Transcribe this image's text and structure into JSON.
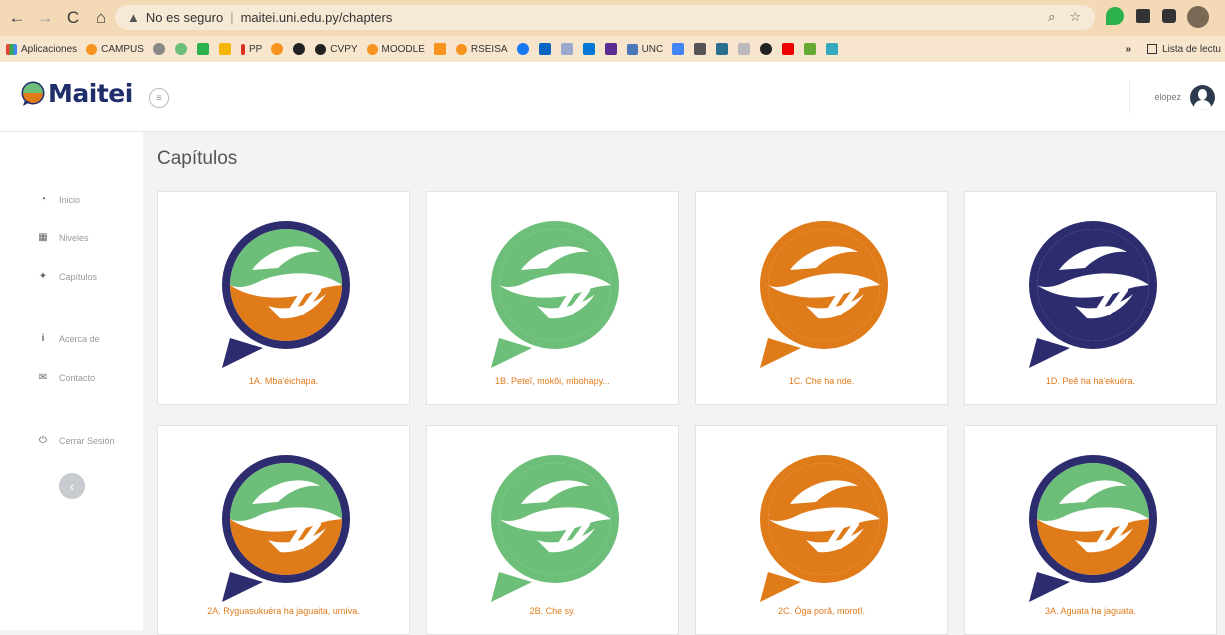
{
  "browser": {
    "security_warning": "No es seguro",
    "url": "maitei.uni.edu.py/chapters",
    "bookmarks": [
      "Aplicaciones",
      "CAMPUS",
      "PP",
      "CVPY",
      "MOODLE",
      "RSEISA",
      "UNC"
    ],
    "reading_list": "Lista de lectu"
  },
  "header": {
    "logo_text": "Maitei",
    "user_name": "elopez"
  },
  "sidebar": {
    "items": [
      {
        "label": "Inicio",
        "icon": "dashboard-icon"
      },
      {
        "label": "Niveles",
        "icon": "grid-icon"
      },
      {
        "label": "Capítulos",
        "icon": "chapters-icon"
      },
      {
        "label": "Acerca de",
        "icon": "info-icon"
      },
      {
        "label": "Contacto",
        "icon": "envelope-icon"
      },
      {
        "label": "Cerrar Sesión",
        "icon": "power-icon"
      }
    ]
  },
  "main": {
    "title": "Capítulos",
    "chapters": [
      {
        "label": "1A. Mba'éichapa.",
        "top": "#6dbe78",
        "bottom": "#e07b1a",
        "ring": "#2c2c6e"
      },
      {
        "label": "1B. Peteĩ, mokõi, mbohapy...",
        "top": "#6dbe78",
        "bottom": "#6dbe78",
        "ring": "#6dbe78"
      },
      {
        "label": "1C. Che ha nde.",
        "top": "#e07b1a",
        "bottom": "#e07b1a",
        "ring": "#e07b1a"
      },
      {
        "label": "1D. Peẽ ha ha'ekuéra.",
        "top": "#2c2c6e",
        "bottom": "#2c2c6e",
        "ring": "#2c2c6e"
      },
      {
        "label": "2A. Ryguasukuéra ha jaguaita, umíva.",
        "top": "#6dbe78",
        "bottom": "#e07b1a",
        "ring": "#2c2c6e"
      },
      {
        "label": "2B. Che sy.",
        "top": "#6dbe78",
        "bottom": "#6dbe78",
        "ring": "#6dbe78"
      },
      {
        "label": "2C. Óga porã, morotĩ.",
        "top": "#e07b1a",
        "bottom": "#e07b1a",
        "ring": "#e07b1a"
      },
      {
        "label": "3A. Aguata ha jaguata.",
        "top": "#6dbe78",
        "bottom": "#e07b1a",
        "ring": "#2c2c6e"
      }
    ]
  }
}
